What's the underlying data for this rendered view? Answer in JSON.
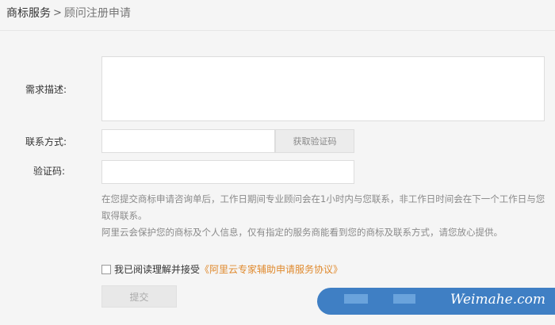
{
  "breadcrumb": {
    "root": "商标服务",
    "separator": ">",
    "current": "顾问注册申请"
  },
  "form": {
    "description_label": "需求描述:",
    "description_value": "",
    "contact_label": "联系方式:",
    "contact_value": "",
    "get_code_button": "获取验证码",
    "code_label": "验证码:",
    "code_value": ""
  },
  "notice": {
    "line1": "在您提交商标申请咨询单后，工作日期间专业顾问会在1小时内与您联系，非工作日时间会在下一个工作日与您取得联系。",
    "line2": "阿里云会保护您的商标及个人信息，仅有指定的服务商能看到您的商标及联系方式，请您放心提供。"
  },
  "agreement": {
    "checked": false,
    "text": "我已阅读理解并接受",
    "link": "《阿里云专家辅助申请服务协议》"
  },
  "submit_button": "提交",
  "watermark": {
    "text": "Weimahe.com"
  },
  "colors": {
    "background": "#f5f5f5",
    "link": "#e08a2e",
    "watermark": "#3f7fc4"
  }
}
